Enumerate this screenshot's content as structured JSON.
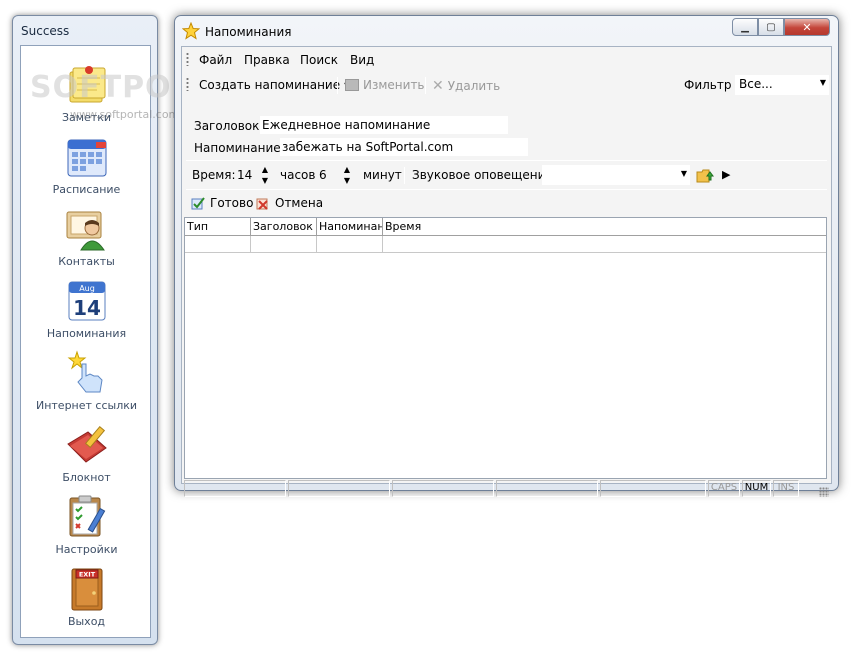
{
  "sidebar": {
    "title": "Success",
    "items": [
      {
        "label": "Заметки",
        "icon": "notes-icon"
      },
      {
        "label": "Расписание",
        "icon": "calendar-icon"
      },
      {
        "label": "Контакты",
        "icon": "contacts-icon"
      },
      {
        "label": "Напоминания",
        "icon": "reminder-calendar-icon"
      },
      {
        "label": "Интернет ссылки",
        "icon": "hand-pointer-icon"
      },
      {
        "label": "Блокнот",
        "icon": "notebook-pencil-icon"
      },
      {
        "label": "Настройки",
        "icon": "settings-checklist-icon"
      },
      {
        "label": "Выход",
        "icon": "exit-door-icon"
      }
    ],
    "calendar_icon_month": "Aug",
    "calendar_icon_day": "14",
    "exit_sign": "EXIT"
  },
  "watermark": {
    "text": "SOFTPORTAL",
    "url": "www.softportal.com"
  },
  "window": {
    "title": "Напоминания"
  },
  "menu": {
    "file": "Файл",
    "edit": "Правка",
    "search": "Поиск",
    "view": "Вид"
  },
  "toolbar": {
    "create": "Создать напоминание",
    "edit": "Изменить",
    "delete": "Удалить",
    "filter_label": "Фильтр",
    "filter_value": "Все..."
  },
  "form": {
    "title_label": "Заголовок:",
    "title_value": "Ежедневное напоминание",
    "reminder_label": "Напоминание:",
    "reminder_value": "забежать на SoftPortal.com",
    "time_label": "Время:",
    "hours_value": "14",
    "hours_label": "часов",
    "minutes_value": "6",
    "minutes_label": "минут",
    "sound_label": "Звуковое оповещение:",
    "sound_value": ""
  },
  "actions": {
    "done": "Готово",
    "cancel": "Отмена"
  },
  "grid": {
    "columns": [
      "Тип",
      "Заголовок",
      "Напоминани",
      "Время"
    ],
    "rows": [
      [
        "",
        "",
        "",
        ""
      ]
    ]
  },
  "status": {
    "caps": "CAPS",
    "num": "NUM",
    "ins": "INS"
  },
  "colors": {
    "close_button": "#c4453a",
    "accent": "#1e5fb0"
  }
}
